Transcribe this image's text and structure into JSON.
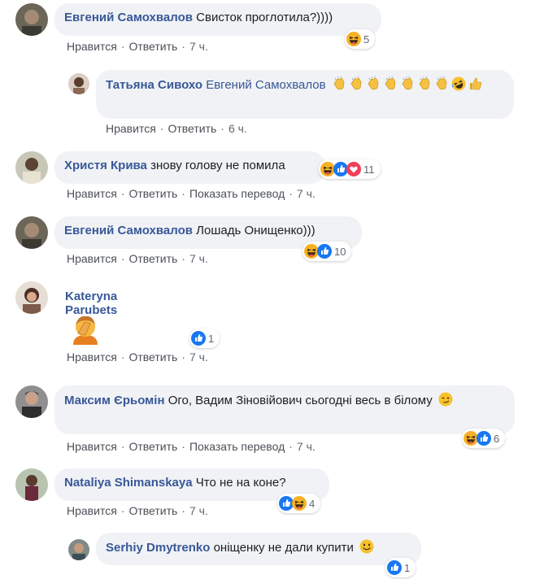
{
  "labels": {
    "like": "Нравится",
    "reply": "Ответить",
    "translate": "Показать перевод",
    "sep": "·"
  },
  "comments": [
    {
      "name": "Евгений Самохвалов",
      "text": "Свисток проглотила?))))",
      "time": "7 ч.",
      "reactions": [
        "haha"
      ],
      "count": "5"
    },
    {
      "name": "Татьяна Сивохо",
      "text": "Евгений Самохвалов",
      "emojis": [
        "clap",
        "clap",
        "clap",
        "clap",
        "clap",
        "clap",
        "clap",
        "rofl",
        "thumbs-up"
      ],
      "time": "6 ч."
    },
    {
      "name": "Христя Крива",
      "text": "знову голову не помила",
      "time": "7 ч.",
      "reactions": [
        "haha",
        "like",
        "love"
      ],
      "count": "11"
    },
    {
      "name": "Евгений Самохвалов",
      "text": "Лошадь Онищенко)))",
      "time": "7 ч.",
      "reactions": [
        "haha",
        "like"
      ],
      "count": "10"
    },
    {
      "name": "Kateryna Parubets",
      "text": "",
      "sticker": "facepalm",
      "time": "7 ч.",
      "reactions": [
        "like"
      ],
      "count": "1"
    },
    {
      "name": "Максим Єрьомін",
      "text": "Ого, Вадим Зіновійович сьогодні весь в білому",
      "emojis": [
        "smirk"
      ],
      "time": "7 ч.",
      "reactions": [
        "haha",
        "like"
      ],
      "count": "6"
    },
    {
      "name": "Nataliya Shimanskaya",
      "text": "Что не на коне?",
      "time": "7 ч.",
      "reactions": [
        "like",
        "haha"
      ],
      "count": "4"
    },
    {
      "name": "Serhiy Dmytrenko",
      "text": "оніщенку не дали купити",
      "emojis": [
        "smile"
      ],
      "time": "",
      "reactions": [
        "like"
      ],
      "count": "1"
    }
  ]
}
